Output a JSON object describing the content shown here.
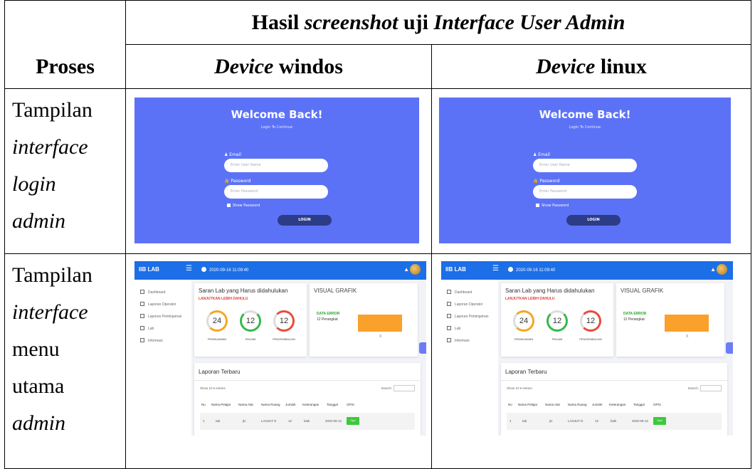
{
  "table": {
    "title_parts": [
      "Hasil ",
      "screenshot",
      " uji ",
      "Interface User Admin"
    ],
    "proses": "Proses",
    "device_windows": [
      "Device",
      " windos"
    ],
    "device_linux": [
      "Device",
      " linux"
    ],
    "row1_lines": [
      "Tampilan",
      "interface",
      "login",
      "admin"
    ],
    "row2_lines": [
      "Tampilan",
      "interface",
      "menu",
      "utama",
      "admin"
    ]
  },
  "login": {
    "welcome": "Welcome Back!",
    "subtitle": "Login To Continue",
    "email_label": "Email",
    "email_placeholder": "Enter User Name",
    "password_label": "Password",
    "password_placeholder": "Enter Password",
    "show_password": "Show Password",
    "login_button": "LOGIN",
    "bg_color": "#5c72f6"
  },
  "dashboard": {
    "brand": "IIB LAB",
    "datetime": "2020-09-16 11:09:40",
    "sidebar": [
      "Dashboard",
      "Laporan Operator",
      "Laporan Peminjaman",
      "Lab",
      "Informasi"
    ],
    "card_title": "Saran Lab yang Harus didahulukan",
    "card_red": "LANJUTKAN LEBIH DAHULU",
    "rings": [
      {
        "value": "24",
        "label": "PEMINJAMAN",
        "color": "#f5a623"
      },
      {
        "value": "12",
        "label": "PINJAM",
        "color": "#35b84b"
      },
      {
        "value": "12",
        "label": "PENGEMBALIAN",
        "color": "#e74c3c"
      }
    ],
    "graph_title": "VISUAL GRAFIK",
    "graph_data_label": "DATA ERROR",
    "graph_data_value": "12 Perangkat",
    "graph_x": "X",
    "list_title": "Laporan Terbaru",
    "show_text": "Show  10  ▾ entries",
    "search_text": "Search:",
    "columns": [
      "No",
      "Nama Pelajar",
      "Nama Alat",
      "Nama Ruang",
      "Jumlah",
      "Keterangan",
      "Tanggal",
      "OPSI"
    ],
    "row": [
      "1",
      "tab",
      "jtz",
      "LANJUT D",
      "12",
      "baik",
      "2020-09-12",
      "Opsi"
    ]
  }
}
